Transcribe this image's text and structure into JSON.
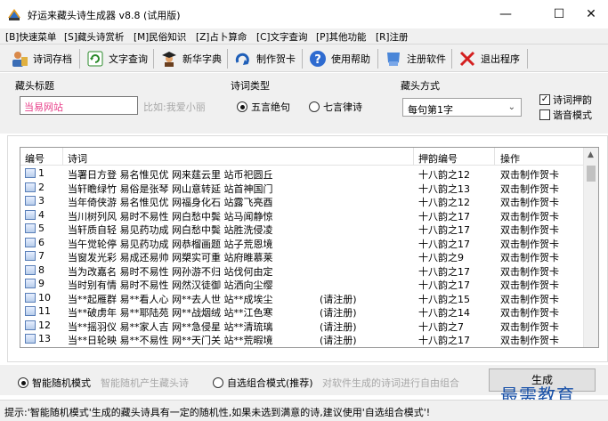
{
  "window": {
    "title": "好运来藏头诗生成器 v8.8 (试用版)",
    "minimize_glyph": "—",
    "maximize_glyph": "☐",
    "close_glyph": "✕"
  },
  "menu": [
    "[B]快速菜单",
    "[S]藏头诗赏析",
    "[M]民俗知识",
    "[Z]占卜算命",
    "[C]文字查询",
    "[P]其他功能",
    "[R]注册"
  ],
  "toolbar": [
    {
      "label": "诗词存档",
      "icon": "user-archive-icon"
    },
    {
      "label": "文字查询",
      "icon": "refresh-search-icon"
    },
    {
      "label": "新华字典",
      "icon": "graduate-dictionary-icon"
    },
    {
      "label": "制作贺卡",
      "icon": "card-arrow-icon"
    },
    {
      "label": "使用帮助",
      "icon": "help-icon"
    },
    {
      "label": "注册软件",
      "icon": "shield-register-icon"
    },
    {
      "label": "退出程序",
      "icon": "exit-x-icon"
    }
  ],
  "form": {
    "title_group": "藏头标题",
    "title_value": "当易网站",
    "title_hint": "比如:我爱小丽",
    "type_group": "诗词类型",
    "type_options": [
      "五言绝句",
      "七言律诗"
    ],
    "type_selected": 0,
    "mode_group": "藏头方式",
    "mode_value": "每句第1字",
    "rhyme_check": "诗词押韵",
    "rhyme_checked": true,
    "homophone_check": "谐音模式",
    "homophone_checked": false
  },
  "table": {
    "columns": [
      "编号",
      "诗词",
      "押韵编号",
      "操作"
    ],
    "rows": [
      {
        "no": "1",
        "poem": "当署日方登  易名惟见优  网来莛云里  站币祀圆丘",
        "note": "",
        "rhyme": "十八韵之12",
        "action": "双击制作贺卡"
      },
      {
        "no": "2",
        "poem": "当轩瞻绿竹  易俗是张琴  网山意转延  站首神国门",
        "note": "",
        "rhyme": "十八韵之13",
        "action": "双击制作贺卡"
      },
      {
        "no": "3",
        "poem": "当年倚侠游  易名惟见优  网福身化石  站露飞亮酉",
        "note": "",
        "rhyme": "十八韵之12",
        "action": "双击制作贺卡"
      },
      {
        "no": "4",
        "poem": "当川树列风  易时不易性  网白愁中鬓  站马闻静惊",
        "note": "",
        "rhyme": "十八韵之17",
        "action": "双击制作贺卡"
      },
      {
        "no": "5",
        "poem": "当轩质自轻  易见药功成  网白愁中鬓  站胜洗侵凌",
        "note": "",
        "rhyme": "十八韵之17",
        "action": "双击制作贺卡"
      },
      {
        "no": "6",
        "poem": "当午觉轮停  易见药功成  网恭榴画题  站子荒恩境",
        "note": "",
        "rhyme": "十八韵之17",
        "action": "双击制作贺卡"
      },
      {
        "no": "7",
        "poem": "当窗发光彩  易成还易帅  网槊实可重  站府睢慕莱",
        "note": "",
        "rhyme": "十八韵之9",
        "action": "双击制作贺卡"
      },
      {
        "no": "8",
        "poem": "当为改嘉名  易时不易性  网孙游不归  站伐何由定",
        "note": "",
        "rhyme": "十八韵之17",
        "action": "双击制作贺卡"
      },
      {
        "no": "9",
        "poem": "当时别有情  易时不易性  网然汉徒御  站洒向尘缨",
        "note": "",
        "rhyme": "十八韵之17",
        "action": "双击制作贺卡"
      },
      {
        "no": "10",
        "poem": "当**起雁群  易**看人心  网**去人世  站**成埃尘",
        "note": "(请注册)",
        "rhyme": "十八韵之15",
        "action": "双击制作贺卡"
      },
      {
        "no": "11",
        "poem": "当**破虏年  易**耶陆苑  网**战烟绒  站**江色寒",
        "note": "(请注册)",
        "rhyme": "十八韵之14",
        "action": "双击制作贺卡"
      },
      {
        "no": "12",
        "poem": "当**摇羽仪  易**家人吉  网**急侵星  站**清琉璃",
        "note": "(请注册)",
        "rhyme": "十八韵之7",
        "action": "双击制作贺卡"
      },
      {
        "no": "13",
        "poem": "当**日轮映  易**不易性  网**天门关  站**荒暇境",
        "note": "(请注册)",
        "rhyme": "十八韵之17",
        "action": "双击制作贺卡"
      }
    ]
  },
  "bottom": {
    "mode1": "智能随机模式",
    "mode1_desc": "智能随机产生藏头诗",
    "mode1_selected": true,
    "mode2": "自选组合模式(推荐)",
    "mode2_desc": "对软件生成的诗词进行自由组合",
    "generate_button": "生成"
  },
  "watermark": "最需教育",
  "status": "提示:'智能随机模式'生成的藏头诗具有一定的随机性,如果未选到满意的诗,建议使用'自选组合模式'!"
}
